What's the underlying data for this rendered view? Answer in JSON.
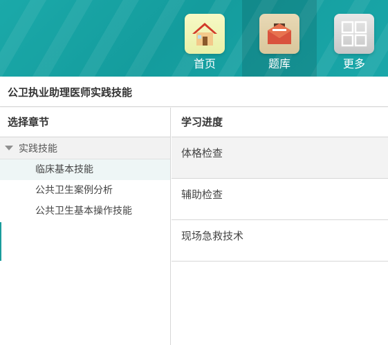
{
  "nav": {
    "items": [
      {
        "label": "首页",
        "icon": "house-icon"
      },
      {
        "label": "题库",
        "icon": "mail-icon"
      },
      {
        "label": "更多",
        "icon": "grid-icon"
      }
    ],
    "active_index": 1
  },
  "course": {
    "title": "公卫执业助理医师实践技能"
  },
  "chapters": {
    "header": "选择章节",
    "group": {
      "label": "实践技能",
      "expanded": true
    },
    "items": [
      {
        "label": "临床基本技能",
        "selected": true
      },
      {
        "label": "公共卫生案例分析",
        "selected": false
      },
      {
        "label": "公共卫生基本操作技能",
        "selected": false
      }
    ]
  },
  "progress": {
    "header": "学习进度",
    "items": [
      {
        "label": "体格检查"
      },
      {
        "label": "辅助检查"
      },
      {
        "label": "现场急救技术"
      }
    ]
  },
  "colors": {
    "header_bg": "#149c9d",
    "accent": "#1a9c9c"
  }
}
